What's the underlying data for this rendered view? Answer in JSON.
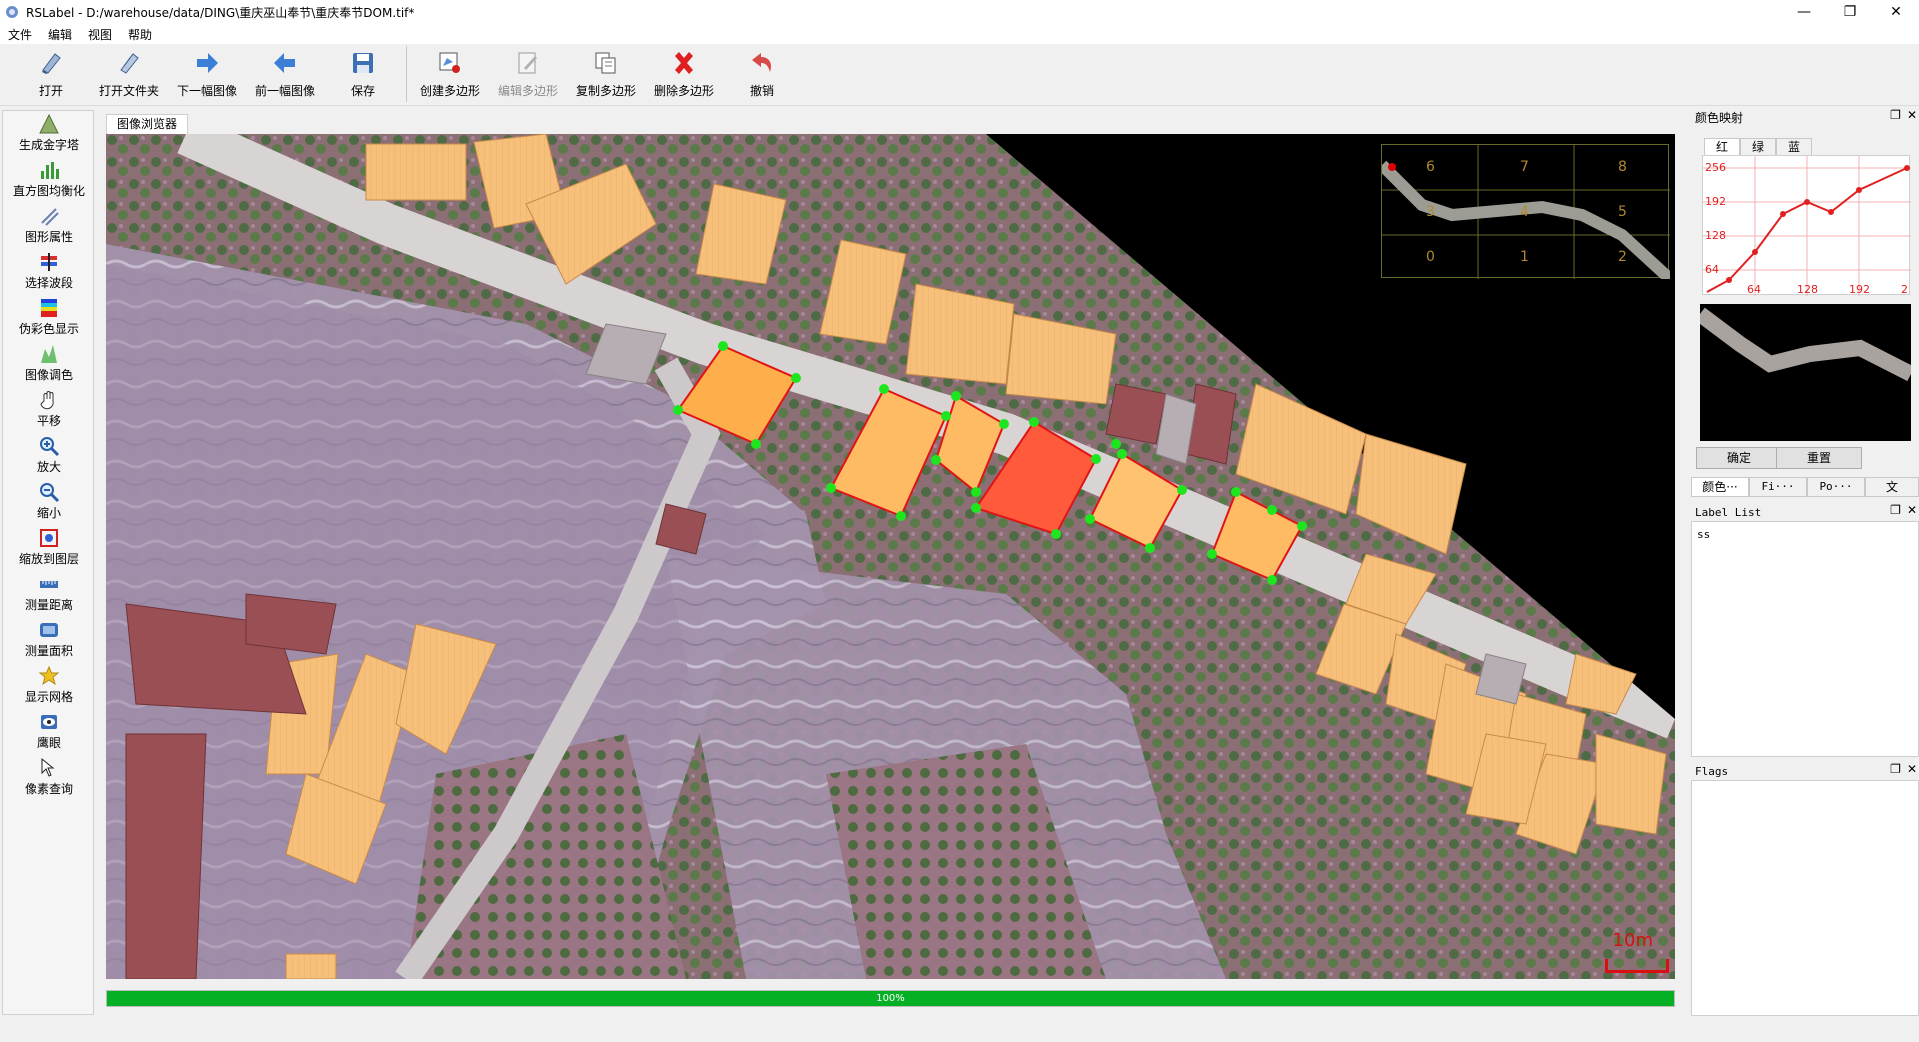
{
  "window": {
    "title": "RSLabel - D:/warehouse/data/DING\\重庆巫山奉节\\重庆奉节DOM.tif*",
    "controls": [
      "—",
      "❐",
      "✕"
    ]
  },
  "menu": [
    "文件",
    "编辑",
    "视图",
    "帮助"
  ],
  "toolbar": {
    "open": "打开",
    "open_folder": "打开文件夹",
    "next_image": "下一幅图像",
    "prev_image": "前一幅图像",
    "save": "保存",
    "create_polygon": "创建多边形",
    "edit_polygon": "编辑多边形",
    "copy_polygon": "复制多边形",
    "delete_polygon": "删除多边形",
    "undo": "撤销"
  },
  "tools": [
    {
      "label": "生成金字塔",
      "icon": "pyramid-icon"
    },
    {
      "label": "直方图均衡化",
      "icon": "histogram-icon"
    },
    {
      "label": "图形属性",
      "icon": "shape-attribute-icon"
    },
    {
      "label": "选择波段",
      "icon": "band-select-icon"
    },
    {
      "label": "伪彩色显示",
      "icon": "pseudo-color-icon"
    },
    {
      "label": "图像调色",
      "icon": "color-adjust-icon"
    },
    {
      "label": "平移",
      "icon": "pan-hand-icon"
    },
    {
      "label": "放大",
      "icon": "zoom-in-icon"
    },
    {
      "label": "缩小",
      "icon": "zoom-out-icon"
    },
    {
      "label": "缩放到图层",
      "icon": "zoom-to-layer-icon"
    },
    {
      "label": "测量距离",
      "icon": "measure-distance-icon"
    },
    {
      "label": "测量面积",
      "icon": "measure-area-icon"
    },
    {
      "label": "显示网格",
      "icon": "grid-icon"
    },
    {
      "label": "鹰眼",
      "icon": "eagle-eye-icon"
    },
    {
      "label": "像素查询",
      "icon": "pixel-query-icon"
    }
  ],
  "viewer": {
    "tab": "图像浏览器",
    "scale_label": "10m",
    "overview_labels": [
      "6",
      "7",
      "8",
      "3",
      "4",
      "5",
      "0",
      "1",
      "2"
    ]
  },
  "progress": {
    "percent": 100,
    "text": "100%"
  },
  "color_map": {
    "title": "颜色映射",
    "channels": [
      "红",
      "绿",
      "蓝"
    ],
    "active_channel": "红",
    "y_ticks": [
      "256",
      "192",
      "128",
      "64"
    ],
    "x_ticks": [
      "64",
      "128",
      "192",
      "2"
    ],
    "confirm": "确定",
    "reset": "重置"
  },
  "dock_tabs": [
    "颜色···",
    "Fi···",
    "Po···",
    "文"
  ],
  "label_list": {
    "title": "Label List",
    "items": [
      "ss"
    ]
  },
  "flags": {
    "title": "Flags"
  },
  "dock_buttons": {
    "float": "❐",
    "close": "✕"
  },
  "colors": {
    "polygon_vertex": "#1ee61e",
    "selected_fill": "#ff5a3c",
    "polygon_fill": "#ffb450",
    "polygon_edge": "#e01414",
    "progress": "#06b025",
    "scale": "#d81010"
  }
}
